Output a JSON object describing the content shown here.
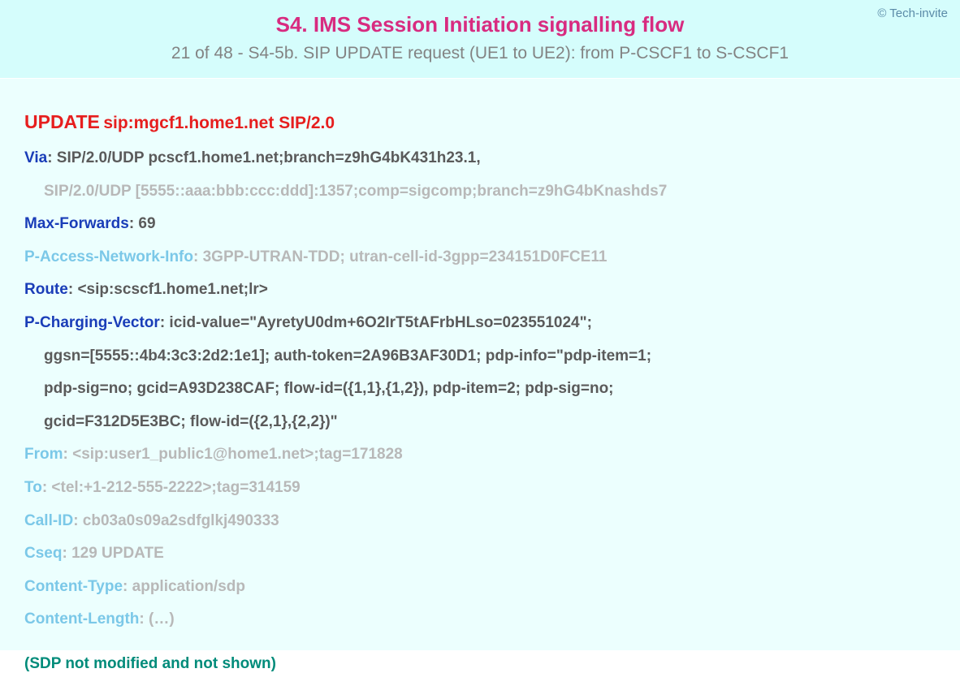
{
  "copyright": "© Tech-invite",
  "title": "S4. IMS Session Initiation signalling flow",
  "subtitle": "21 of 48 - S4-5b. SIP UPDATE request (UE1 to UE2): from P-CSCF1 to S-CSCF1",
  "request": {
    "method": "UPDATE",
    "uri": "sip:mgcf1.home1.net SIP/2.0"
  },
  "headers": {
    "via": {
      "name": "Via",
      "value1": "SIP/2.0/UDP pcscf1.home1.net;branch=z9hG4bK431h23.1,",
      "value2": "SIP/2.0/UDP [5555::aaa:bbb:ccc:ddd]:1357;comp=sigcomp;branch=z9hG4bKnashds7"
    },
    "maxForwards": {
      "name": "Max-Forwards",
      "value": "69"
    },
    "pAccessNetworkInfo": {
      "name": "P-Access-Network-Info",
      "value": "3GPP-UTRAN-TDD; utran-cell-id-3gpp=234151D0FCE11"
    },
    "route": {
      "name": "Route",
      "value": "<sip:scscf1.home1.net;lr>"
    },
    "pChargingVector": {
      "name": "P-Charging-Vector",
      "value1": "icid-value=\"AyretyU0dm+6O2IrT5tAFrbHLso=023551024\";",
      "value2": "ggsn=[5555::4b4:3c3:2d2:1e1]; auth-token=2A96B3AF30D1; pdp-info=\"pdp-item=1;",
      "value3": "pdp-sig=no; gcid=A93D238CAF; flow-id=({1,1},{1,2}), pdp-item=2; pdp-sig=no;",
      "value4": "gcid=F312D5E3BC; flow-id=({2,1},{2,2})\""
    },
    "from": {
      "name": "From",
      "value": "<sip:user1_public1@home1.net>;tag=171828"
    },
    "to": {
      "name": "To",
      "value": "<tel:+1-212-555-2222>;tag=314159"
    },
    "callId": {
      "name": "Call-ID",
      "value": "cb03a0s09a2sdfglkj490333"
    },
    "cseq": {
      "name": "Cseq",
      "value": "129 UPDATE"
    },
    "contentType": {
      "name": "Content-Type",
      "value": "application/sdp"
    },
    "contentLength": {
      "name": "Content-Length",
      "value": "(…)"
    }
  },
  "sdpNote": "(SDP not modified and not shown)"
}
